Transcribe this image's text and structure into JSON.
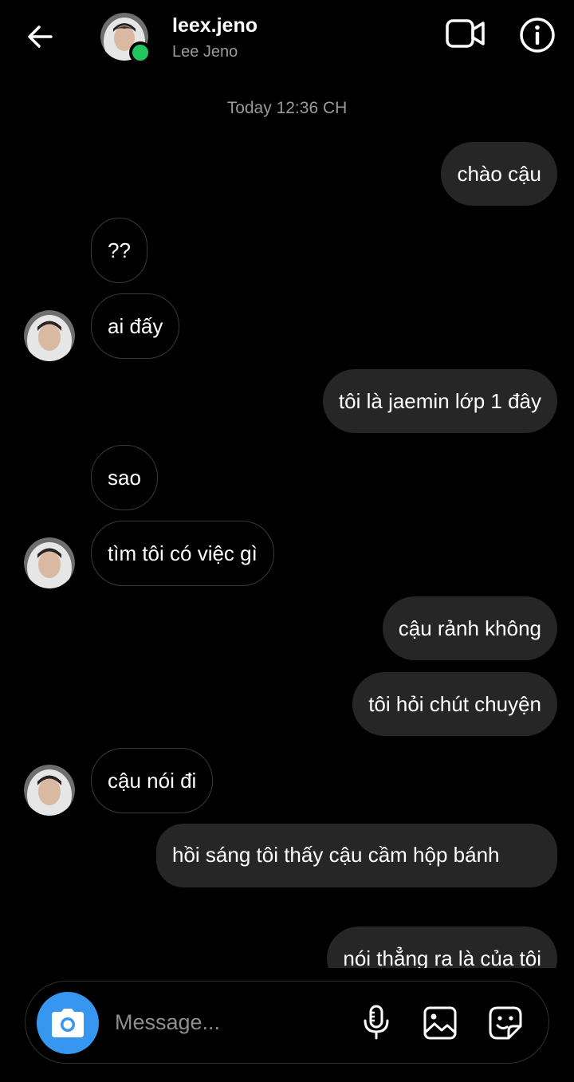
{
  "header": {
    "username": "leex.jeno",
    "fullname": "Lee Jeno",
    "online": true,
    "back_icon": "arrow-left-icon",
    "video_icon": "video-camera-icon",
    "info_icon": "info-icon"
  },
  "thread": {
    "timestamp": "Today 12:36 CH",
    "messages": [
      {
        "from": "me",
        "text": "chào cậu"
      },
      {
        "from": "them",
        "text": "??"
      },
      {
        "from": "them",
        "text": "ai đấy",
        "avatar": true
      },
      {
        "from": "me",
        "text": "tôi là jaemin lớp 1 đây"
      },
      {
        "from": "them",
        "text": "sao"
      },
      {
        "from": "them",
        "text": "tìm tôi có việc gì",
        "avatar": true
      },
      {
        "from": "me",
        "text": "cậu rảnh không"
      },
      {
        "from": "me",
        "text": "tôi hỏi chút chuyện"
      },
      {
        "from": "them",
        "text": "cậu nói đi",
        "avatar": true
      },
      {
        "from": "me",
        "text": "hồi sáng tôi thấy cậu cầm hộp bánh"
      },
      {
        "from": "me",
        "text": "nói thẳng ra là của tôi"
      }
    ]
  },
  "composer": {
    "placeholder": "Message...",
    "camera_icon": "camera-icon",
    "mic_icon": "microphone-icon",
    "gallery_icon": "gallery-icon",
    "sticker_icon": "sticker-icon"
  },
  "colors": {
    "background": "#000000",
    "outgoing_bubble": "#262626",
    "incoming_border": "#3a3a3a",
    "accent_blue": "#3797f0",
    "online_green": "#22c55e"
  }
}
